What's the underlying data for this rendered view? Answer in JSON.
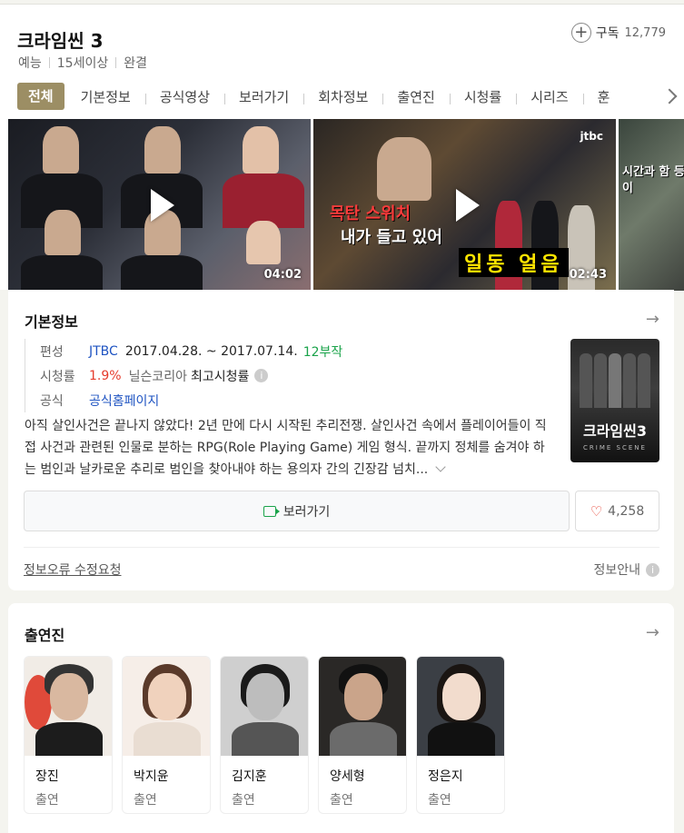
{
  "header": {
    "title": "크라임씬 3",
    "subscribe_label": "구독",
    "subscribe_count": "12,779",
    "meta": [
      "예능",
      "15세이상",
      "완결"
    ]
  },
  "tabs": [
    "전체",
    "기본정보",
    "공식영상",
    "보러가기",
    "회차정보",
    "출연진",
    "시청률",
    "시리즈",
    "훈"
  ],
  "videos": [
    {
      "duration": "04:02"
    },
    {
      "duration": "02:43",
      "channel": "jtbc",
      "caption_red": "목탄 스위치",
      "caption_white": "내가 들고 있어",
      "caption_yellow": "일동 얼음"
    },
    {
      "caption": "시간과 함 등이"
    }
  ],
  "basic_info": {
    "title": "기본정보",
    "network_label": "편성",
    "network": "JTBC",
    "dates": "2017.04.28. ~ 2017.07.14.",
    "episodes": "12부작",
    "rating_label": "시청률",
    "rating": "1.9%",
    "rating_source": "닐슨코리아",
    "rating_note": "최고시청률",
    "official_label": "공식",
    "official_link": "공식홈페이지",
    "poster_title": "크라임씬3",
    "poster_sub": "CRIME SCENE",
    "description": "아직 살인사건은 끝나지 않았다! 2년 만에 다시 시작된 추리전쟁. 살인사건 속에서 플레이어들이 직접 사건과 관련된 인물로 분하는 RPG(Role Playing Game) 게임 형식. 끝까지 정체를 숨겨야 하는 범인과 날카로운 추리로 범인을 찾아내야 하는 용의자 간의 긴장감 넘치...",
    "watch_button": "보러가기",
    "like_count": "4,258",
    "report_link": "정보오류 수정요청",
    "info_guide": "정보안내"
  },
  "cast_section": {
    "title": "출연진",
    "members": [
      {
        "name": "장진",
        "role": "출연"
      },
      {
        "name": "박지윤",
        "role": "출연"
      },
      {
        "name": "김지훈",
        "role": "출연"
      },
      {
        "name": "양세형",
        "role": "출연"
      },
      {
        "name": "정은지",
        "role": "출연"
      }
    ]
  },
  "colors": {
    "active_tab": "#9c8e64",
    "link_blue": "#1f54c2",
    "rating_red": "#e53b2c",
    "episode_green": "#1aa34a"
  }
}
